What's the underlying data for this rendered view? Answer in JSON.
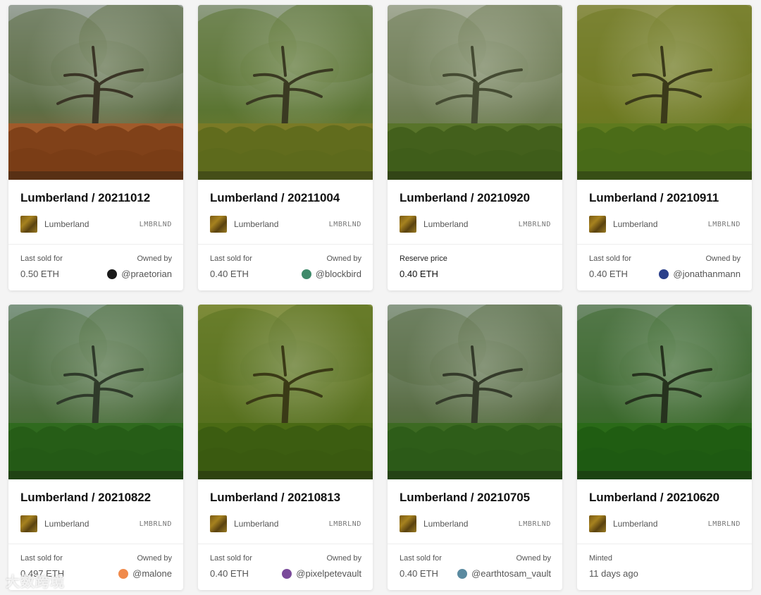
{
  "cards": [
    {
      "title": "Lumberland / 20211012",
      "collection": "Lumberland",
      "symbol": "LMBRLND",
      "status_label": "Last sold for",
      "price": "0.50 ETH",
      "owner_label": "Owned by",
      "owner": "@praetorian",
      "avatar_color": "#1a1a1a",
      "palette": {
        "sky": "#9aa39a",
        "canopy": "#5d6e45",
        "trunk": "#3a3526",
        "ground": "#a05a2a",
        "ferns": "#7a3d16"
      }
    },
    {
      "title": "Lumberland / 20211004",
      "collection": "Lumberland",
      "symbol": "LMBRLND",
      "status_label": "Last sold for",
      "price": "0.40 ETH",
      "owner_label": "Owned by",
      "owner": "@blockbird",
      "avatar_color": "#3f8a6a",
      "palette": {
        "sky": "#8e9c82",
        "canopy": "#5b7532",
        "trunk": "#3a3a22",
        "ground": "#7a7a26",
        "ferns": "#5d6a1c"
      }
    },
    {
      "title": "Lumberland / 20210920",
      "collection": "Lumberland",
      "symbol": "LMBRLND",
      "status_label": "Reserve price",
      "price": "0.40 ETH",
      "owner_label": "",
      "owner": "",
      "avatar_color": "",
      "palette": {
        "sky": "#a3aa96",
        "canopy": "#6f7d55",
        "trunk": "#444a32",
        "ground": "#58742a",
        "ferns": "#3f5d1a"
      }
    },
    {
      "title": "Lumberland / 20210911",
      "collection": "Lumberland",
      "symbol": "LMBRLND",
      "status_label": "Last sold for",
      "price": "0.40 ETH",
      "owner_label": "Owned by",
      "owner": "@jonathanmann",
      "avatar_color": "#2a3f8a",
      "palette": {
        "sky": "#8b8f4a",
        "canopy": "#6f7a22",
        "trunk": "#3b3a1a",
        "ground": "#5e7a1e",
        "ferns": "#486a18"
      }
    },
    {
      "title": "Lumberland / 20210822",
      "collection": "Lumberland",
      "symbol": "LMBRLND",
      "status_label": "Last sold for",
      "price": "0.497 ETH",
      "owner_label": "Owned by",
      "owner": "@malone",
      "avatar_color": "#f08a4b",
      "palette": {
        "sky": "#7e9682",
        "canopy": "#4d6e3e",
        "trunk": "#2f3a2a",
        "ground": "#2f6a1e",
        "ferns": "#245a16"
      }
    },
    {
      "title": "Lumberland / 20210813",
      "collection": "Lumberland",
      "symbol": "LMBRLND",
      "status_label": "Last sold for",
      "price": "0.40 ETH",
      "owner_label": "Owned by",
      "owner": "@pixelpetevault",
      "avatar_color": "#7a4a9a",
      "palette": {
        "sky": "#7e8c3a",
        "canopy": "#5a7220",
        "trunk": "#3a3a16",
        "ground": "#4a6a14",
        "ferns": "#3a5a10"
      }
    },
    {
      "title": "Lumberland / 20210705",
      "collection": "Lumberland",
      "symbol": "LMBRLND",
      "status_label": "Last sold for",
      "price": "0.40 ETH",
      "owner_label": "Owned by",
      "owner": "@earthtosam_vault",
      "avatar_color": "#5a8aa0",
      "palette": {
        "sky": "#8a9a86",
        "canopy": "#5a6e46",
        "trunk": "#343a2a",
        "ground": "#3c6a22",
        "ferns": "#2c5a18"
      }
    },
    {
      "title": "Lumberland / 20210620",
      "collection": "Lumberland",
      "symbol": "LMBRLND",
      "status_label": "Minted",
      "price": "11 days ago",
      "owner_label": "",
      "owner": "",
      "avatar_color": "",
      "palette": {
        "sky": "#6e8a6a",
        "canopy": "#3e6a30",
        "trunk": "#26321e",
        "ground": "#2a6a18",
        "ferns": "#1e5a12"
      }
    }
  ],
  "watermark": "大数跨境"
}
